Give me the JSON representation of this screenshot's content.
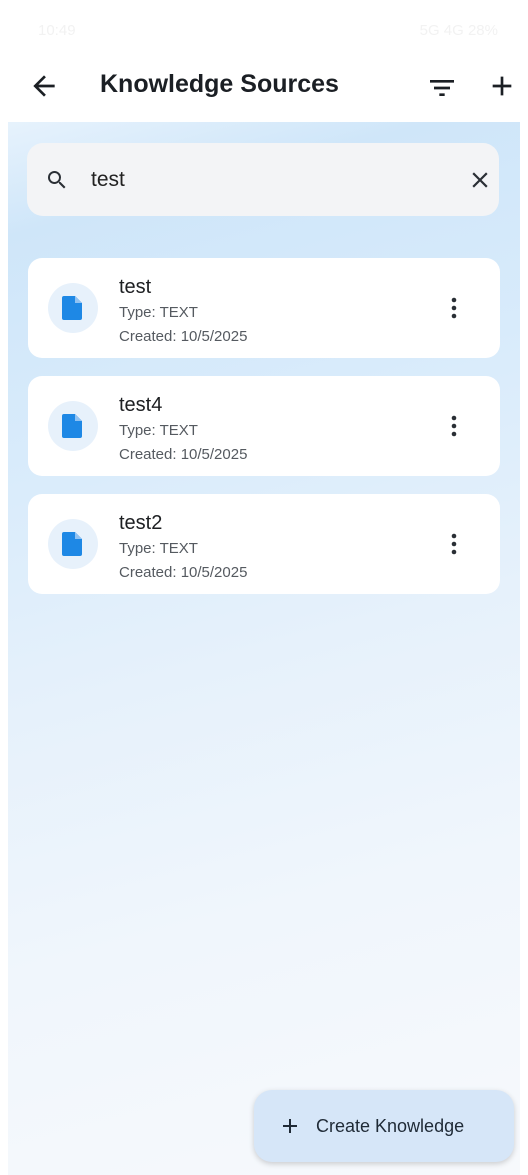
{
  "status_bar": {
    "time": "10:49",
    "right": "5G 4G 28%"
  },
  "app_bar": {
    "title": "Knowledge Sources",
    "back_icon": "arrow-back-icon",
    "filter_icon": "filter-icon",
    "add_icon": "plus-icon"
  },
  "search": {
    "value": "test",
    "search_icon": "search-icon",
    "clear_icon": "close-icon"
  },
  "items": [
    {
      "name": "test",
      "type": "Type: TEXT",
      "created": "Created: 10/5/2025"
    },
    {
      "name": "test4",
      "type": "Type: TEXT",
      "created": "Created: 10/5/2025"
    },
    {
      "name": "test2",
      "type": "Type: TEXT",
      "created": "Created: 10/5/2025"
    }
  ],
  "fab": {
    "label": "Create Knowledge",
    "icon": "plus-icon"
  },
  "colors": {
    "accent": "#1e88e5",
    "avatar_bg": "#e7f1fb",
    "fab_bg": "#d6e6f8"
  }
}
